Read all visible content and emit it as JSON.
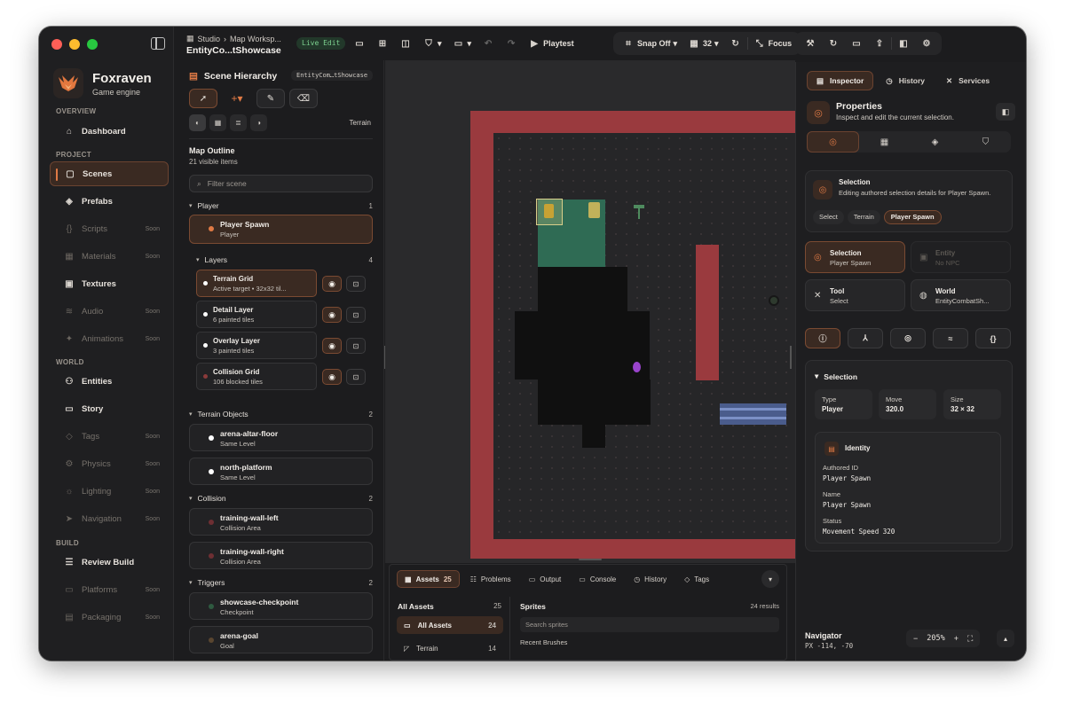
{
  "app": {
    "name": "Foxraven",
    "subtitle": "Game engine"
  },
  "sidebar": {
    "sections": [
      "OVERVIEW",
      "PROJECT",
      "WORLD",
      "BUILD"
    ],
    "items": [
      {
        "label": "Dashboard",
        "icon": "home-icon",
        "state": "normal"
      },
      {
        "label": "Scenes",
        "icon": "box-icon",
        "state": "active"
      },
      {
        "label": "Prefabs",
        "icon": "cube-icon",
        "state": "normal"
      },
      {
        "label": "Scripts",
        "icon": "braces-icon",
        "state": "soon"
      },
      {
        "label": "Materials",
        "icon": "grid-icon",
        "state": "soon"
      },
      {
        "label": "Textures",
        "icon": "image-icon",
        "state": "normal"
      },
      {
        "label": "Audio",
        "icon": "waveform-icon",
        "state": "soon"
      },
      {
        "label": "Animations",
        "icon": "sparkle-icon",
        "state": "soon"
      },
      {
        "label": "Entities",
        "icon": "users-icon",
        "state": "normal"
      },
      {
        "label": "Story",
        "icon": "chat-icon",
        "state": "normal"
      },
      {
        "label": "Tags",
        "icon": "tag-icon",
        "state": "soon"
      },
      {
        "label": "Physics",
        "icon": "gear-icon",
        "state": "soon"
      },
      {
        "label": "Lighting",
        "icon": "sun-icon",
        "state": "soon"
      },
      {
        "label": "Navigation",
        "icon": "navigation-icon",
        "state": "soon"
      },
      {
        "label": "Review Build",
        "icon": "checklist-icon",
        "state": "normal"
      },
      {
        "label": "Platforms",
        "icon": "screen-icon",
        "state": "soon"
      },
      {
        "label": "Packaging",
        "icon": "package-icon",
        "state": "soon"
      }
    ],
    "soon_label": "Soon"
  },
  "toolbar": {
    "crumb_studio": "Studio",
    "crumb_workspace": "Map Worksp...",
    "title": "EntityCo...tShowcase",
    "mode_badge": "Live Edit",
    "playtest": "Playtest",
    "snap": "Snap Off",
    "grid_size": "32",
    "focus": "Focus"
  },
  "hierarchy": {
    "title": "Scene Hierarchy",
    "tag": "EntityCom…tShowcase",
    "mode_label": "Terrain",
    "outline_title": "Map Outline",
    "outline_sub": "21 visible items",
    "filter_placeholder": "Filter scene",
    "groups": {
      "player": {
        "label": "Player",
        "count": "1"
      },
      "layers": {
        "label": "Layers",
        "count": "4"
      },
      "terrain": {
        "label": "Terrain Objects",
        "count": "2"
      },
      "collision": {
        "label": "Collision",
        "count": "2"
      },
      "triggers": {
        "label": "Triggers",
        "count": "2"
      }
    },
    "player_row": {
      "name": "Player Spawn",
      "sub": "Player",
      "dot": "#e07a45"
    },
    "layers": [
      {
        "name": "Terrain Grid",
        "sub": "Active target • 32x32 til...",
        "dot": "#ffffff"
      },
      {
        "name": "Detail Layer",
        "sub": "6 painted tiles",
        "dot": "#ffffff"
      },
      {
        "name": "Overlay Layer",
        "sub": "3 painted tiles",
        "dot": "#ffffff"
      },
      {
        "name": "Collision Grid",
        "sub": "106 blocked tiles",
        "dot": "#8a3a3a"
      }
    ],
    "terrain_rows": [
      {
        "name": "arena-altar-floor",
        "sub": "Same Level",
        "dot": "#ffffff"
      },
      {
        "name": "north-platform",
        "sub": "Same Level",
        "dot": "#ffffff"
      }
    ],
    "collision_rows": [
      {
        "name": "training-wall-left",
        "sub": "Collision Area",
        "dot": "#6e2f33"
      },
      {
        "name": "training-wall-right",
        "sub": "Collision Area",
        "dot": "#6e2f33"
      }
    ],
    "trigger_rows": [
      {
        "name": "showcase-checkpoint",
        "sub": "Checkpoint",
        "dot": "#2f5a40"
      },
      {
        "name": "arena-goal",
        "sub": "Goal",
        "dot": "#5a4630"
      }
    ]
  },
  "assets_panel": {
    "tabs": [
      {
        "label": "Assets",
        "count": "25",
        "icon": "grid-icon"
      },
      {
        "label": "Problems",
        "icon": "list-icon"
      },
      {
        "label": "Output",
        "icon": "folder-icon"
      },
      {
        "label": "Console",
        "icon": "terminal-icon"
      },
      {
        "label": "History",
        "icon": "clock-icon"
      },
      {
        "label": "Tags",
        "icon": "tag-icon"
      }
    ],
    "left_title": "All Assets",
    "left_count": "25",
    "items": [
      {
        "label": "All Assets",
        "count": "24"
      },
      {
        "label": "Terrain",
        "count": "14"
      }
    ],
    "right_title": "Sprites",
    "results": "24 results",
    "search_placeholder": "Search sprites",
    "recent": "Recent Brushes"
  },
  "inspector": {
    "tabs": [
      {
        "label": "Inspector",
        "icon": "panel-icon"
      },
      {
        "label": "History",
        "icon": "history-icon"
      },
      {
        "label": "Services",
        "icon": "services-icon"
      }
    ],
    "title": "Properties",
    "subtitle": "Inspect and edit the current selection.",
    "selection_card": {
      "title": "Selection",
      "desc": "Editing authored selection details for Player Spawn.",
      "chips": [
        "Select",
        "Terrain",
        "Player Spawn"
      ]
    },
    "mini_cards": [
      {
        "title": "Selection",
        "sub": "Player Spawn",
        "state": "active"
      },
      {
        "title": "Entity",
        "sub": "No NPC",
        "state": "disabled"
      },
      {
        "title": "Tool",
        "sub": "Select",
        "state": "normal"
      },
      {
        "title": "World",
        "sub": "EntityCombatSh...",
        "state": "normal"
      }
    ],
    "section_title": "Selection",
    "stats": [
      {
        "label": "Type",
        "value": "Player"
      },
      {
        "label": "Move",
        "value": "320.0"
      },
      {
        "label": "Size",
        "value": "32 × 32"
      }
    ],
    "identity": {
      "title": "Identity",
      "authored_id_label": "Authored ID",
      "authored_id": "Player Spawn",
      "name_label": "Name",
      "name": "Player Spawn",
      "status_label": "Status",
      "status": "Movement Speed 320"
    },
    "navigator_title": "Navigator",
    "navigator_sub": "PX -114, -70",
    "zoom": "205%"
  },
  "colors": {
    "accent": "#e07a45",
    "wall": "#9a3a3e",
    "grass": "#2f6b54",
    "live": "#7cd08f"
  }
}
